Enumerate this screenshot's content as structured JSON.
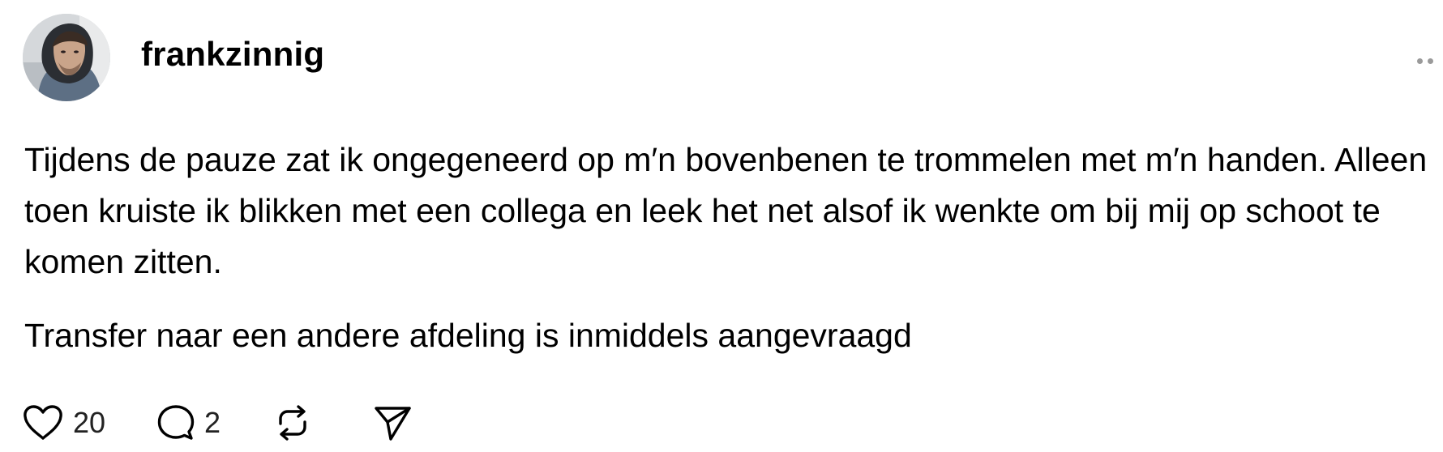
{
  "post": {
    "author": {
      "username": "frankzinnig",
      "avatar_icon": "user-avatar-photo"
    },
    "menu_icon": "more-options-icon",
    "paragraphs": [
      "Tijdens de pauze zat ik ongegeneerd op m′n bovenbenen te trommelen met m′n handen. Alleen toen kruiste ik blikken met een collega en leek het net alsof ik wenkte om bij mij op schoot te komen zitten.",
      "Transfer naar een andere afdeling is inmiddels aangevraagd"
    ],
    "actions": {
      "like": {
        "icon": "heart-icon",
        "count": "20"
      },
      "reply": {
        "icon": "speech-bubble-icon",
        "count": "2"
      },
      "repost": {
        "icon": "repost-icon"
      },
      "share": {
        "icon": "paper-plane-icon"
      }
    }
  }
}
